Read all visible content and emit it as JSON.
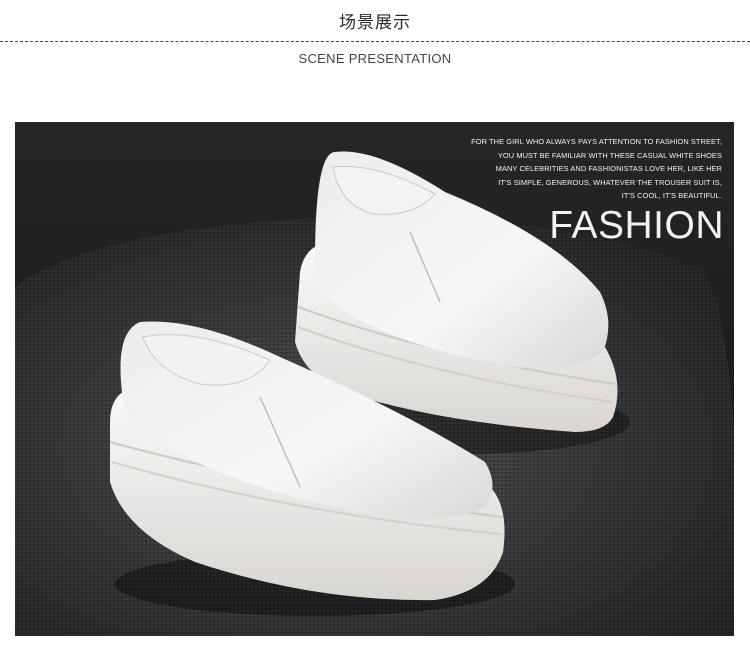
{
  "header": {
    "title": "场景展示",
    "subtitle": "SCENE PRESENTATION"
  },
  "photo": {
    "caption_lines": [
      "FOR THE GIRL WHO ALWAYS PAYS ATTENTION TO FASHION STREET,",
      "YOU MUST BE FAMILIAR WITH THESE CASUAL WHITE SHOES",
      "MANY CELEBRITIES AND FASHIONISTAS LOVE HER, LIKE HER",
      "IT'S SIMPLE, GENEROUS, WHATEVER THE TROUSER SUIT IS,",
      "IT'S COOL, IT'S BEAUTIFUL."
    ],
    "headline": "FASHION"
  }
}
